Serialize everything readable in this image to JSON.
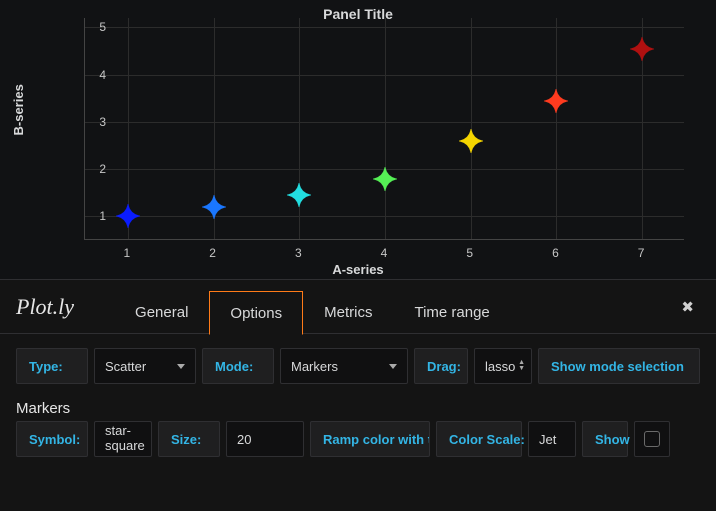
{
  "chart_data": {
    "type": "scatter",
    "title": "Panel Title",
    "xlabel": "A-series",
    "ylabel": "B-series",
    "xlim": [
      0.5,
      7.5
    ],
    "ylim": [
      0.5,
      5.2
    ],
    "x_ticks": [
      1,
      2,
      3,
      4,
      5,
      6,
      7
    ],
    "y_ticks": [
      1,
      2,
      3,
      4,
      5
    ],
    "series": [
      {
        "name": "B-series",
        "symbol": "star-square",
        "color_scale": "Jet",
        "points": [
          {
            "x": 1,
            "y": 1.0,
            "color": "#0a1cff"
          },
          {
            "x": 2,
            "y": 1.2,
            "color": "#1a77ff"
          },
          {
            "x": 3,
            "y": 1.45,
            "color": "#22dde0"
          },
          {
            "x": 4,
            "y": 1.8,
            "color": "#55f055"
          },
          {
            "x": 5,
            "y": 2.6,
            "color": "#f5d500"
          },
          {
            "x": 6,
            "y": 3.45,
            "color": "#ff3b1f"
          },
          {
            "x": 7,
            "y": 4.55,
            "color": "#b01010"
          }
        ]
      }
    ]
  },
  "editor": {
    "plugin_name": "Plot.ly",
    "tabs": {
      "general": "General",
      "options": "Options",
      "metrics": "Metrics",
      "time_range": "Time range",
      "active": "Options"
    },
    "row1": {
      "type_label": "Type:",
      "type_value": "Scatter",
      "mode_label": "Mode:",
      "mode_value": "Markers",
      "drag_label": "Drag:",
      "drag_value": "lasso",
      "show_mode_link": "Show mode selection"
    },
    "markers_heading": "Markers",
    "row2": {
      "symbol_label": "Symbol:",
      "symbol_value": "star-square",
      "size_label": "Size:",
      "size_value": "20",
      "ramp_label": "Ramp color with t",
      "colorscale_label": "Color Scale:",
      "colorscale_value": "Jet",
      "show_label": "Show"
    }
  }
}
